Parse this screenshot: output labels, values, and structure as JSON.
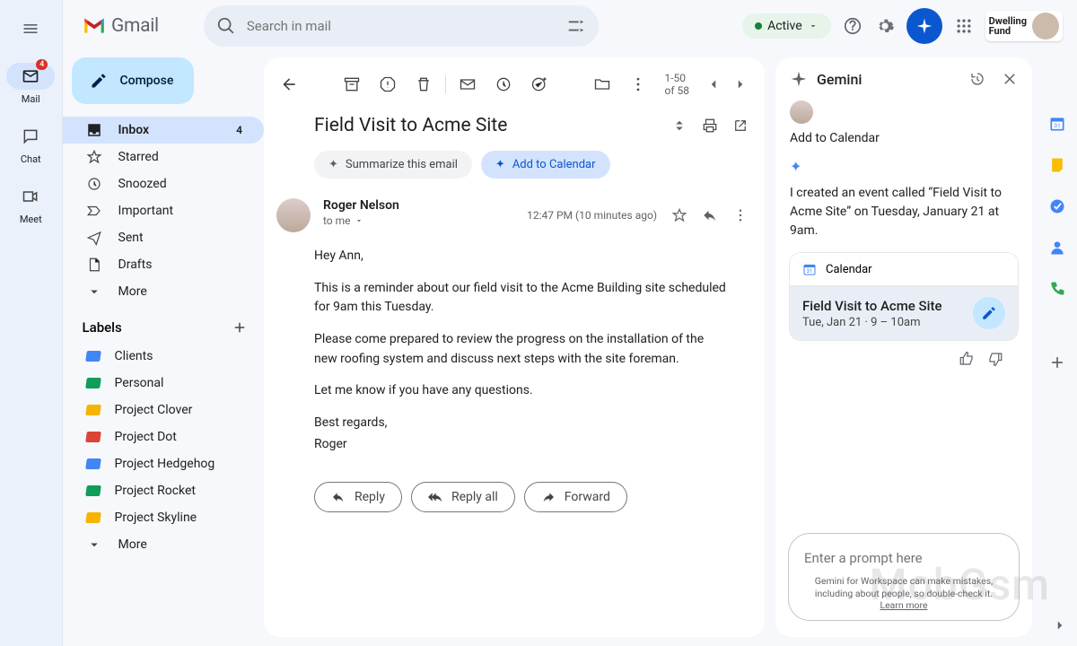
{
  "app": {
    "name": "Gmail"
  },
  "rail": {
    "mail": "Mail",
    "mail_badge": "4",
    "chat": "Chat",
    "meet": "Meet"
  },
  "header": {
    "search_placeholder": "Search in mail",
    "status": "Active",
    "org": "Dwelling\nFund"
  },
  "compose": "Compose",
  "nav": {
    "inbox": "Inbox",
    "inbox_count": "4",
    "starred": "Starred",
    "snoozed": "Snoozed",
    "important": "Important",
    "sent": "Sent",
    "drafts": "Drafts",
    "more": "More"
  },
  "labels": {
    "header": "Labels",
    "items": [
      {
        "name": "Clients",
        "color": "#4285f4"
      },
      {
        "name": "Personal",
        "color": "#0f9d58"
      },
      {
        "name": "Project Clover",
        "color": "#f4b400"
      },
      {
        "name": "Project Dot",
        "color": "#db4437"
      },
      {
        "name": "Project Hedgehog",
        "color": "#4285f4"
      },
      {
        "name": "Project Rocket",
        "color": "#0f9d58"
      },
      {
        "name": "Project Skyline",
        "color": "#f4b400"
      }
    ],
    "more": "More"
  },
  "toolbar": {
    "count": "1-50 of 58"
  },
  "email": {
    "subject": "Field Visit to Acme Site",
    "chips": {
      "summarize": "Summarize this email",
      "calendar": "Add to Calendar"
    },
    "sender": "Roger Nelson",
    "to": "to me",
    "time": "12:47 PM (10 minutes ago)",
    "p1": "Hey Ann,",
    "p2": "This is a reminder about our field visit to the Acme Building site scheduled for 9am this Tuesday.",
    "p3": "Please come prepared to review the progress on the installation of the new roofing system and discuss next steps with the site foreman.",
    "p4": "Let me know if you have any questions.",
    "p5": "Best regards,",
    "p6": "Roger",
    "reply": "Reply",
    "reply_all": "Reply all",
    "forward": "Forward"
  },
  "gemini": {
    "title": "Gemini",
    "user_prompt": "Add to Calendar",
    "reply": "I created an event called “Field Visit to Acme Site” on Tuesday, January 21 at 9am.",
    "cal_app": "Calendar",
    "event_title": "Field Visit to Acme Site",
    "event_time": "Tue, Jan 21 · 9 – 10am",
    "prompt_placeholder": "Enter a prompt here",
    "disclaim": "Gemini for Workspace can make mistakes, including about people, so double-check it.",
    "learn": "Learn more"
  }
}
